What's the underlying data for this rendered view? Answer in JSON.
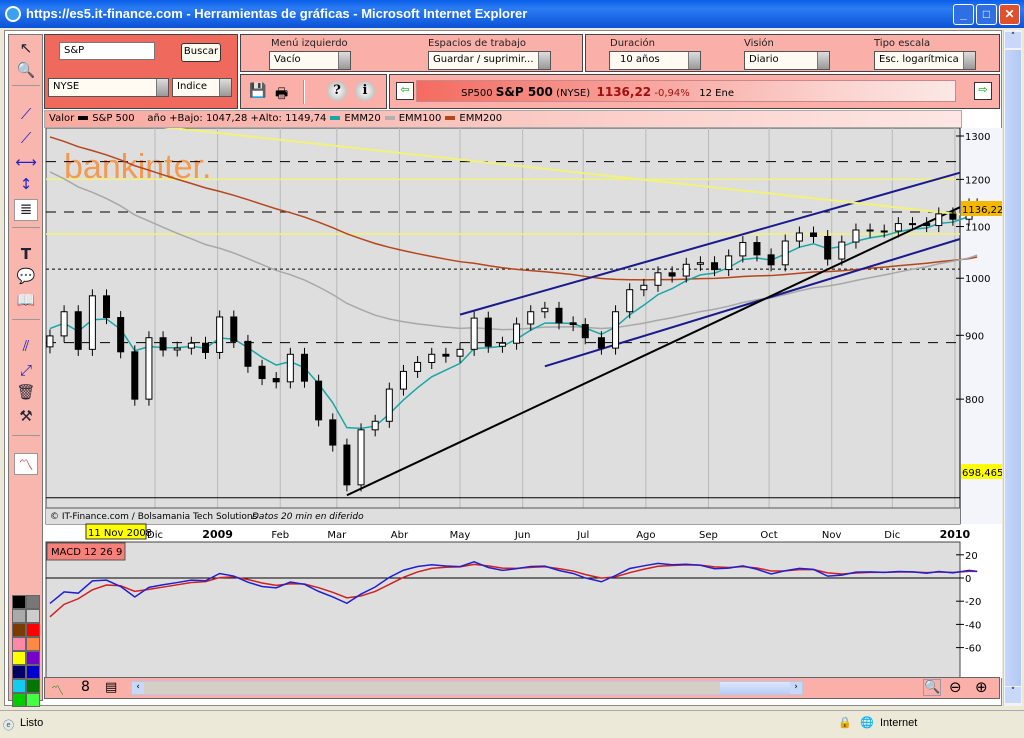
{
  "window": {
    "title": "https://es5.it-finance.com - Herramientas de gráficas - Microsoft Internet Explorer",
    "min": "_",
    "max": "□",
    "close": "✕"
  },
  "search": {
    "value": "S&P",
    "button": "Buscar",
    "market": "NYSE",
    "type": "Indice"
  },
  "menu": {
    "left_label": "Menú izquierdo",
    "left_value": "Vacío",
    "workspace_label": "Espacios de trabajo",
    "workspace_value": "Guardar / suprimir...",
    "duration_label": "Duración",
    "duration_value": "10 años",
    "view_label": "Visión",
    "view_value": "Diario",
    "scale_label": "Tipo escala",
    "scale_value": "Esc. logarítmica"
  },
  "ticker": {
    "code": "SP500",
    "name": "S&P 500",
    "market": "(NYSE)",
    "price": "1136,22",
    "change": "-0,94%",
    "date": "12 Ene"
  },
  "legend": {
    "valor": "Valor",
    "series": "S&P 500",
    "range": "año +Bajo: 1047,28 +Alto: 1149,74",
    "ema20": "EMM20",
    "ema100": "EMM100",
    "ema200": "EMM200"
  },
  "colors": {
    "ema20": "#1aa6a6",
    "ema100": "#a8a8a8",
    "ema200": "#b5461a",
    "channel": "#1a1a8c",
    "support": "#000000",
    "resistance": "#f2f27a",
    "frame": "#fab0a8"
  },
  "watermark": "bankinter.",
  "credit": "© IT-Finance.com / Bolsamania Tech Solutions",
  "credit_note": "Datos 20 min en diferido",
  "cursor_date": "11 Nov 2008",
  "price_markers": {
    "last": "1136,22",
    "low": "698,465"
  },
  "macd_label": "MACD 12 26 9",
  "status": {
    "text": "Listo",
    "zone": "Internet"
  },
  "chart_data": {
    "type": "candlestick",
    "scale": "log",
    "ylim": [
      650,
      1340
    ],
    "yticks": [
      800,
      900,
      1000,
      1100,
      1200,
      1300
    ],
    "xticks": [
      {
        "d": "2008-12-01",
        "l": "Dic"
      },
      {
        "d": "2009-01-01",
        "l": "2009",
        "bold": true
      },
      {
        "d": "2009-02-01",
        "l": "Feb"
      },
      {
        "d": "2009-03-01",
        "l": "Mar"
      },
      {
        "d": "2009-04-01",
        "l": "Abr"
      },
      {
        "d": "2009-05-01",
        "l": "May"
      },
      {
        "d": "2009-06-01",
        "l": "Jun"
      },
      {
        "d": "2009-07-01",
        "l": "Jul"
      },
      {
        "d": "2009-08-01",
        "l": "Ago"
      },
      {
        "d": "2009-09-01",
        "l": "Sep"
      },
      {
        "d": "2009-10-01",
        "l": "Oct"
      },
      {
        "d": "2009-11-01",
        "l": "Nov"
      },
      {
        "d": "2009-12-01",
        "l": "Dic"
      },
      {
        "d": "2010-01-01",
        "l": "2010",
        "bold": true
      }
    ],
    "weekly": [
      [
        "2008-10-10",
        899
      ],
      [
        "2008-10-17",
        940
      ],
      [
        "2008-10-24",
        877
      ],
      [
        "2008-10-31",
        968
      ],
      [
        "2008-11-07",
        930
      ],
      [
        "2008-11-14",
        873
      ],
      [
        "2008-11-21",
        800
      ],
      [
        "2008-11-28",
        896
      ],
      [
        "2008-12-05",
        876
      ],
      [
        "2008-12-12",
        879
      ],
      [
        "2008-12-19",
        887
      ],
      [
        "2008-12-26",
        872
      ],
      [
        "2009-01-02",
        931
      ],
      [
        "2009-01-09",
        890
      ],
      [
        "2009-01-16",
        850
      ],
      [
        "2009-01-23",
        831
      ],
      [
        "2009-01-30",
        826
      ],
      [
        "2009-02-06",
        869
      ],
      [
        "2009-02-13",
        827
      ],
      [
        "2009-02-20",
        770
      ],
      [
        "2009-02-27",
        735
      ],
      [
        "2009-03-06",
        683
      ],
      [
        "2009-03-13",
        756
      ],
      [
        "2009-03-20",
        768
      ],
      [
        "2009-03-27",
        815
      ],
      [
        "2009-04-03",
        842
      ],
      [
        "2009-04-10",
        856
      ],
      [
        "2009-04-17",
        869
      ],
      [
        "2009-04-24",
        866
      ],
      [
        "2009-05-01",
        877
      ],
      [
        "2009-05-08",
        929
      ],
      [
        "2009-05-15",
        882
      ],
      [
        "2009-05-22",
        887
      ],
      [
        "2009-05-29",
        919
      ],
      [
        "2009-06-05",
        940
      ],
      [
        "2009-06-12",
        946
      ],
      [
        "2009-06-19",
        921
      ],
      [
        "2009-06-26",
        918
      ],
      [
        "2009-07-02",
        896
      ],
      [
        "2009-07-10",
        879
      ],
      [
        "2009-07-17",
        940
      ],
      [
        "2009-07-24",
        979
      ],
      [
        "2009-07-31",
        987
      ],
      [
        "2009-08-07",
        1010
      ],
      [
        "2009-08-14",
        1004
      ],
      [
        "2009-08-21",
        1026
      ],
      [
        "2009-08-28",
        1029
      ],
      [
        "2009-09-04",
        1016
      ],
      [
        "2009-09-11",
        1042
      ],
      [
        "2009-09-18",
        1068
      ],
      [
        "2009-09-25",
        1044
      ],
      [
        "2009-10-02",
        1025
      ],
      [
        "2009-10-09",
        1071
      ],
      [
        "2009-10-16",
        1087
      ],
      [
        "2009-10-23",
        1080
      ],
      [
        "2009-10-30",
        1036
      ],
      [
        "2009-11-06",
        1069
      ],
      [
        "2009-11-13",
        1093
      ],
      [
        "2009-11-20",
        1091
      ],
      [
        "2009-11-27",
        1091
      ],
      [
        "2009-12-04",
        1106
      ],
      [
        "2009-12-11",
        1106
      ],
      [
        "2009-12-18",
        1102
      ],
      [
        "2009-12-24",
        1126
      ],
      [
        "2009-12-31",
        1115
      ],
      [
        "2010-01-08",
        1145
      ],
      [
        "2010-01-12",
        1136
      ]
    ],
    "trendlines": [
      {
        "kind": "channel",
        "from": [
          "2009-05-01",
          935
        ],
        "to": [
          "2010-01-25",
          1215
        ]
      },
      {
        "kind": "channel",
        "from": [
          "2009-06-12",
          850
        ],
        "to": [
          "2010-01-25",
          1075
        ]
      },
      {
        "kind": "support",
        "from": [
          "2009-03-06",
          670
        ],
        "to": [
          "2010-01-25",
          1140
        ]
      },
      {
        "kind": "resistance",
        "from": [
          "2008-11-20",
          1330
        ],
        "to": [
          "2010-01-25",
          1125
        ]
      }
    ],
    "hlines": [
      {
        "v": 1200,
        "style": "yellow"
      },
      {
        "v": 1085,
        "style": "yellow"
      },
      {
        "v": 1240,
        "style": "dashed"
      },
      {
        "v": 1017,
        "style": "dotted"
      },
      {
        "v": 888,
        "style": "dashed"
      },
      {
        "v": 1130,
        "style": "dashed"
      },
      {
        "v": 667,
        "style": "solid"
      }
    ],
    "macd": {
      "yticks": [
        20,
        0,
        -20,
        -40,
        -60
      ],
      "ylim": [
        -72,
        28
      ]
    }
  }
}
